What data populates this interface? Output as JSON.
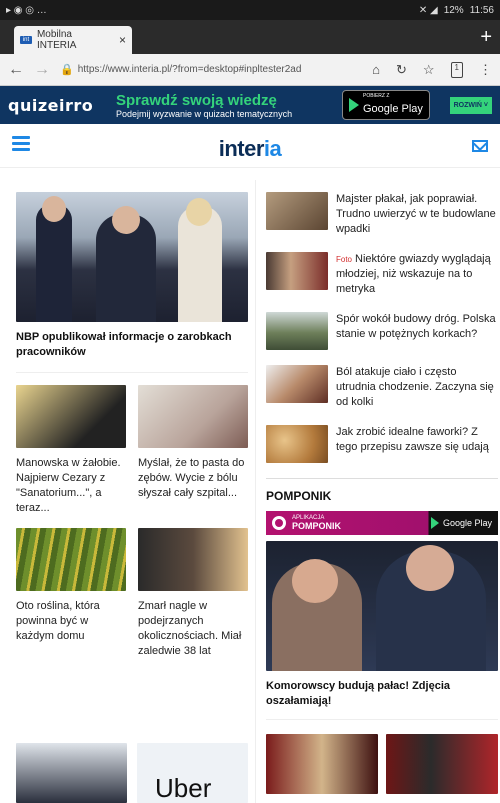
{
  "status": {
    "time": "11:56",
    "battery": "12%",
    "left_icons": "▸ ◉ ◎ …",
    "signal": "✕ ◢"
  },
  "tab": {
    "title": "Mobilna INTERIA",
    "close": "×",
    "favicon": "int"
  },
  "newtab": "+",
  "address": {
    "url": "https://www.interia.pl/?from=desktop#inpltester2ad",
    "tab_count": "1"
  },
  "ad": {
    "brand": "quizeirro",
    "headline": "Sprawdź swoją wiedzę",
    "subline": "Podejmij wyzwanie w quizach tematycznych",
    "store_small": "POBIERZ Z",
    "store_big": "Google Play",
    "expand": "ROZWIŃ ˅"
  },
  "site": {
    "logo_main": "inter",
    "logo_accent": "ia"
  },
  "hero": {
    "headline": "NBP opublikował informacje o zarobkach pracowników"
  },
  "left_tiles": [
    {
      "caption": "Manowska w żałobie. Najpierw Cezary z \"Sanatorium...\", a teraz..."
    },
    {
      "caption": "Myślał, że to pasta do zębów. Wycie z bólu słyszał cały szpital..."
    },
    {
      "caption": "Oto roślina, która powinna być w każdym domu"
    },
    {
      "caption": "Zmarł nagle w podejrzanych okolicznościach. Miał zaledwie 38 lat"
    }
  ],
  "right_list": [
    {
      "text": "Majster płakał, jak poprawiał. Trudno uwierzyć w te budowlane wpadki",
      "tag": ""
    },
    {
      "text": "Niektóre gwiazdy wyglądają młodziej, niż wskazuje na to metryka",
      "tag": "Foto"
    },
    {
      "text": "Spór wokół budowy dróg. Polska stanie w potężnych korkach?",
      "tag": ""
    },
    {
      "text": "Ból atakuje ciało i często utrudnia chodzenie. Zaczyna się od kolki",
      "tag": ""
    },
    {
      "text": "Jak zrobić idealne faworki? Z tego przepisu zawsze się udają",
      "tag": ""
    }
  ],
  "pomponik": {
    "section_title": "POMPONIK",
    "app_line1": "APLIKACJA",
    "app_line2": "POMPONIK",
    "store": "Google Play",
    "headline": "Komorowscy budują pałac! Zdjęcia oszałamiają!"
  },
  "bottom": {
    "uber_text": "Uber"
  }
}
